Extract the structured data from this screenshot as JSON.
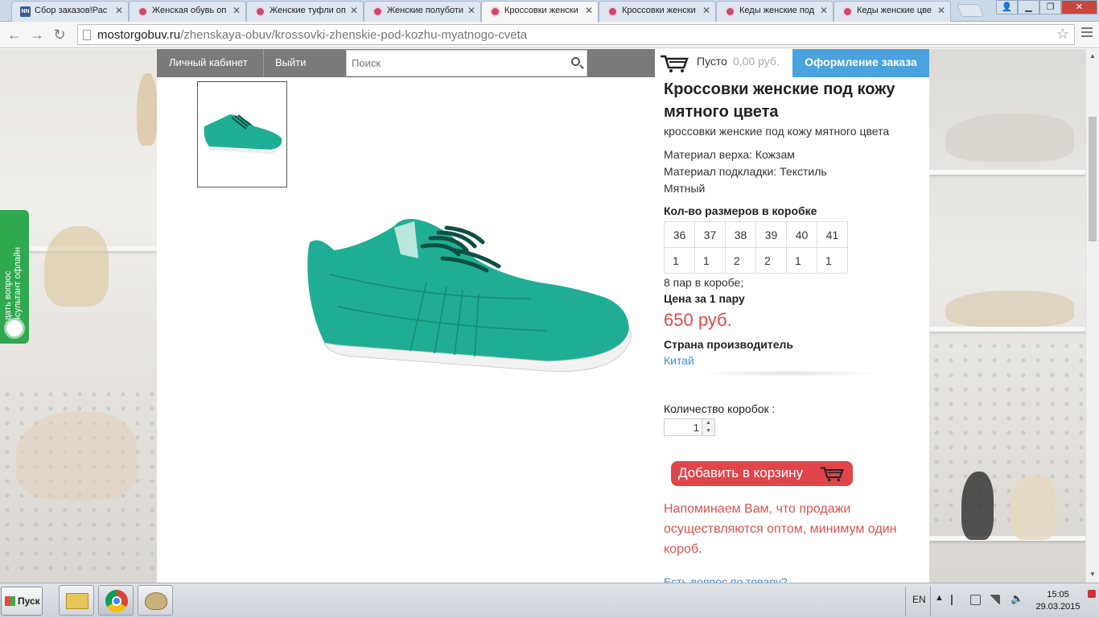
{
  "browser": {
    "tabs": [
      {
        "label": "Сбор заказов!Рас",
        "icon": "nn-icon"
      },
      {
        "label": "Женская обувь оп",
        "icon": "flower-icon"
      },
      {
        "label": "Женские туфли оп",
        "icon": "flower-icon"
      },
      {
        "label": "Женские полуботи",
        "icon": "flower-icon"
      },
      {
        "label": "Кроссовки женски",
        "icon": "flower-icon",
        "active": true
      },
      {
        "label": "Кроссовки женски",
        "icon": "flower-icon"
      },
      {
        "label": "Кеды женские под",
        "icon": "flower-icon"
      },
      {
        "label": "Кеды женские цве",
        "icon": "flower-icon"
      }
    ],
    "url_host": "mostorgobuv.ru",
    "url_path": "/zhenskaya-obuv/krossovki-zhenskie-pod-kozhu-myatnogo-cveta"
  },
  "site": {
    "account_label": "Личный кабинет",
    "logout_label": "Выйти",
    "search_placeholder": "Поиск",
    "cart_empty": "Пусто",
    "cart_sum": "0,00 руб.",
    "checkout_label": "Оформление заказа"
  },
  "consultant": {
    "line1": "Задать вопрос",
    "line2": "консультант офлайн"
  },
  "product": {
    "title": "Кроссовки женские под кожу мятного цвета",
    "subtitle": "кроссовки женские под кожу мятного цвета",
    "material_top": "Материал верха: Кожзам",
    "material_lining": "Материал подкладки: Текстиль",
    "color": "Мятный",
    "sizes_heading": "Кол-во размеров в коробке",
    "sizes": [
      "36",
      "37",
      "38",
      "39",
      "40",
      "41"
    ],
    "quantities": [
      "1",
      "1",
      "2",
      "2",
      "1",
      "1"
    ],
    "pairs_per_box": "8 пар в коробе;",
    "price_heading": "Цена за 1 пару",
    "price": "650 руб.",
    "country_heading": "Страна производитель",
    "country": "Китай",
    "boxes_label": "Количество коробок :",
    "boxes_value": "1",
    "add_to_cart": "Добавить в корзину",
    "notice": "Напоминаем Вам, что продажи осуществляются оптом, минимум один короб.",
    "question_link": "Есть вопрос по товару?",
    "shoe_color": "#1fae93"
  },
  "taskbar": {
    "start_label": "Пуск",
    "lang": "EN",
    "time": "15:05",
    "date": "29.03.2015"
  }
}
